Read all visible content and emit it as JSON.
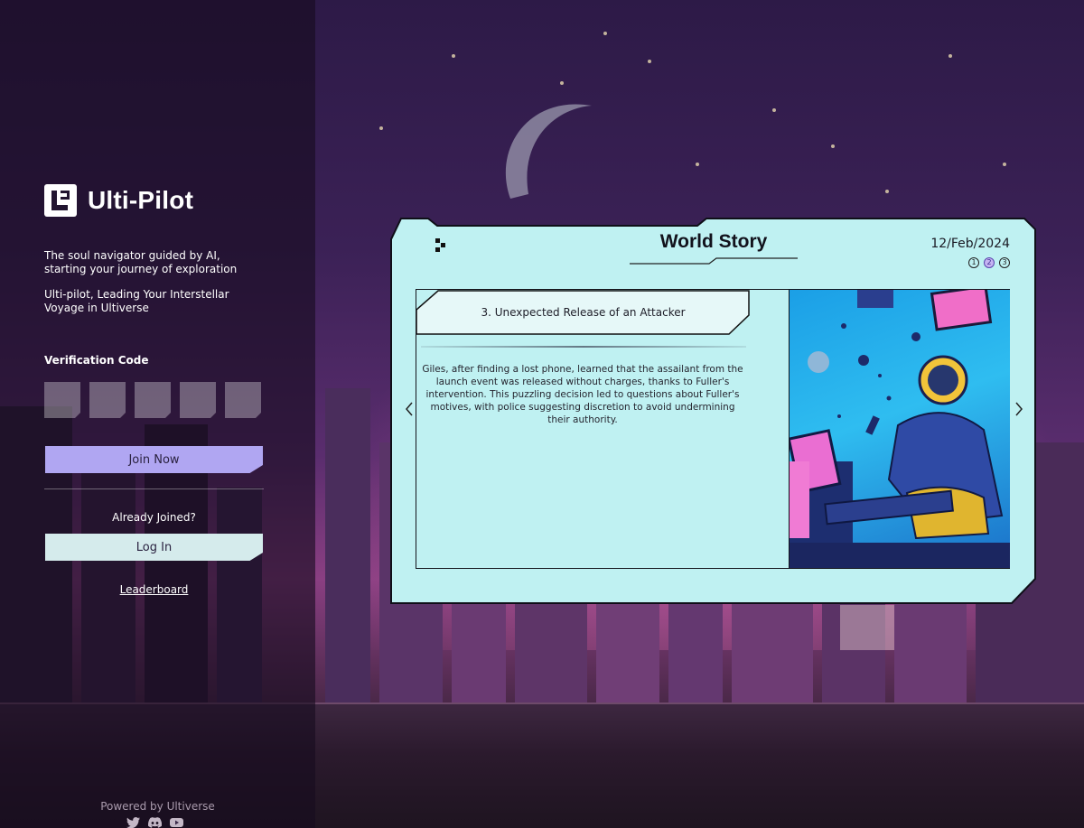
{
  "brand": {
    "name": "Ulti-Pilot"
  },
  "taglines": [
    "The soul navigator guided by AI, starting your journey of exploration",
    "Ulti-pilot, Leading Your Interstellar Voyage in Ultiverse"
  ],
  "verification": {
    "label": "Verification Code",
    "box_count": 5
  },
  "actions": {
    "join_label": "Join Now",
    "already_joined": "Already Joined?",
    "login_label": "Log In",
    "leaderboard_label": "Leaderboard"
  },
  "footer": {
    "powered_by": "Powered by Ultiverse",
    "socials": [
      "twitter-icon",
      "discord-icon",
      "youtube-icon"
    ]
  },
  "story": {
    "title": "World Story",
    "date": "12/Feb/2024",
    "pages": [
      "1",
      "2",
      "3"
    ],
    "active_page": 2,
    "chapter_title": "3. Unexpected Release of an Attacker",
    "body": "Giles, after finding a lost phone, learned that the assailant from the launch event was released without charges, thanks to Fuller's intervention. This puzzling decision led to questions about Fuller's motives, with police suggesting discretion to avoid undermining their authority."
  },
  "colors": {
    "card_bg": "#bff1f2",
    "join_button": "#b0a6f2",
    "login_button": "#d5ebec",
    "active_page": "#c5b4f2"
  }
}
